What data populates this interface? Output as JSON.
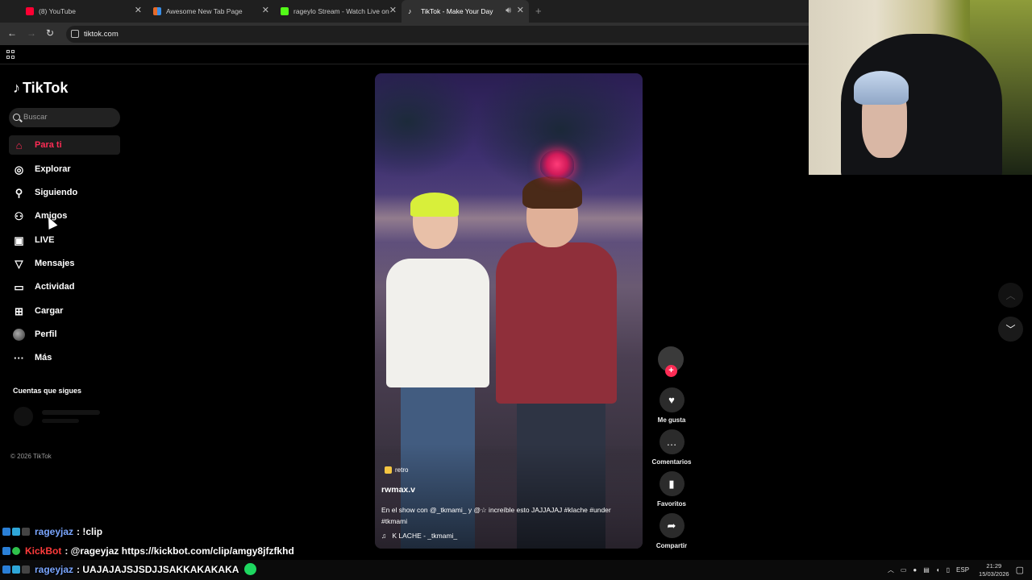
{
  "tabs": [
    {
      "title": "(8) YouTube",
      "color": "#ff0033"
    },
    {
      "title": "Awesome New Tab Page",
      "color": "#e46a2a"
    },
    {
      "title": "rageylo Stream - Watch Live on",
      "color": "#53fc18"
    },
    {
      "title": "TikTok - Make Your Day",
      "color": "#ffffff"
    }
  ],
  "tab_close": "✕",
  "new_tab": "+",
  "address": {
    "url": "tiktok.com"
  },
  "tiktok": {
    "logo": "TikTok",
    "search_placeholder": "Buscar",
    "nav": [
      {
        "label": "Para ti",
        "icon": "home-icon"
      },
      {
        "label": "Explorar",
        "icon": "compass-icon"
      },
      {
        "label": "Siguiendo",
        "icon": "user-follow-icon"
      },
      {
        "label": "Amigos",
        "icon": "friends-icon"
      },
      {
        "label": "LIVE",
        "icon": "live-icon"
      },
      {
        "label": "Mensajes",
        "icon": "send-icon"
      },
      {
        "label": "Actividad",
        "icon": "activity-icon"
      },
      {
        "label": "Cargar",
        "icon": "upload-icon"
      },
      {
        "label": "Perfil",
        "icon": "avatar-icon"
      },
      {
        "label": "Más",
        "icon": "more-icon"
      }
    ],
    "following_title": "Cuentas que sigues",
    "copyright": "© 2026 TikTok"
  },
  "video": {
    "badge": "retro",
    "username": "rwmax.v",
    "description": "En el show con @_tkmami_ y @☆ increíble esto JAJJAJAJ #klache #under #tkmami",
    "music": "K LACHE - _tkmami_"
  },
  "actions": {
    "like": "Me gusta",
    "comments": "Comentarios",
    "favorites": "Favoritos",
    "share": "Compartir"
  },
  "chat": [
    {
      "user": "rageyjaz",
      "user_color": "#7aa6ff",
      "message": ": !clip"
    },
    {
      "user": "KickBot",
      "user_color": "#ff3b3b",
      "message": ": @rageyjaz https://kickbot.com/clip/amgy8jfzfkhd"
    },
    {
      "user": "rageyjaz",
      "user_color": "#7aa6ff",
      "message": ": UAJAJAJSJSDJJSAKKAKAKAKA"
    }
  ],
  "taskbar": {
    "language": "ESP",
    "time": "21:29",
    "date": "15/03/2026"
  },
  "colors": {
    "accent": "#fe2c55",
    "bg": "#000000"
  }
}
